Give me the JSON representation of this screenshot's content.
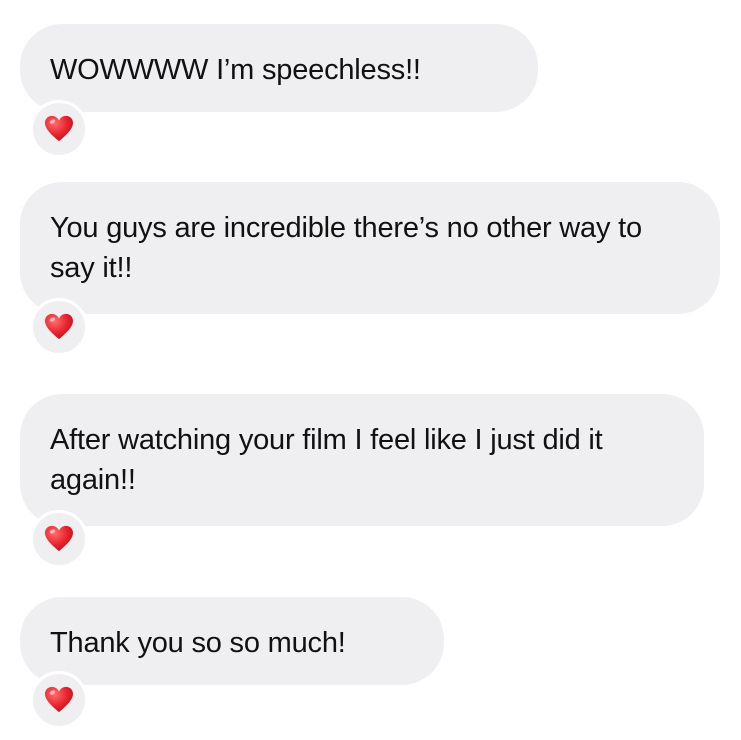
{
  "messages": [
    {
      "text": "WOWWWW I’m speechless!!",
      "reaction": "heart-emoji"
    },
    {
      "text": "You guys are incredible there’s no other way to say it!!",
      "reaction": "heart-emoji"
    },
    {
      "text": "After watching your film I feel like I just did it again!!",
      "reaction": "heart-emoji"
    },
    {
      "text": "Thank you so so much!",
      "reaction": "heart-emoji"
    }
  ],
  "colors": {
    "bubble_background": "#efeff1",
    "text": "#111111",
    "heart": "#e8232e"
  }
}
